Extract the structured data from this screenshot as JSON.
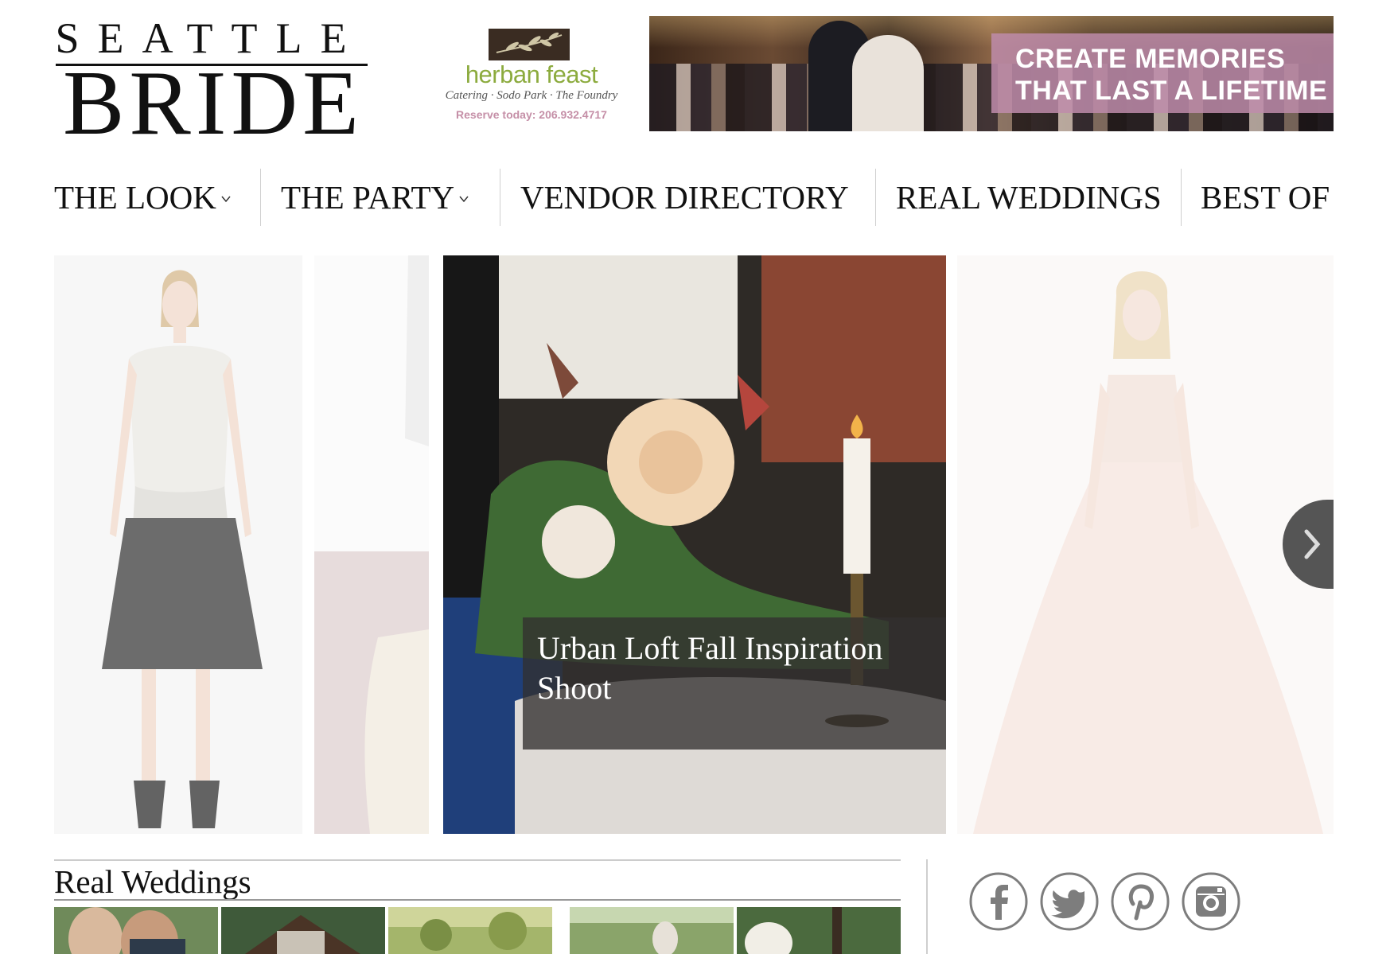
{
  "logo": {
    "top": "SEATTLE",
    "bottom": "BRIDE"
  },
  "ads": {
    "herban": {
      "mark_icon": "olive-branch-icon",
      "name": "herban feast",
      "tagline": "Catering · Sodo Park · The Foundry",
      "phone": "Reserve today: 206.932.4717"
    },
    "banner": {
      "line1": "CREATE MEMORIES",
      "line2": "THAT LAST A LIFETIME"
    }
  },
  "nav": {
    "items": [
      {
        "label": "THE LOOK",
        "dropdown": true
      },
      {
        "label": "THE PARTY",
        "dropdown": true
      },
      {
        "label": "VENDOR DIRECTORY",
        "dropdown": false
      },
      {
        "label": "REAL WEDDINGS",
        "dropdown": false
      },
      {
        "label": "BEST OF",
        "dropdown": false
      }
    ],
    "chevron_icon": "chevron-down-icon"
  },
  "carousel": {
    "caption": "Urban Loft Fall Inspiration Shoot",
    "next_icon": "chevron-right-icon"
  },
  "real_weddings": {
    "title": "Real Weddings"
  },
  "social": [
    {
      "name": "facebook-icon"
    },
    {
      "name": "twitter-icon"
    },
    {
      "name": "pinterest-icon"
    },
    {
      "name": "instagram-icon"
    }
  ],
  "colors": {
    "herban_green": "#8cab3e",
    "herban_pink": "#c58fa7",
    "ad_overlay": "#be8caa",
    "icon_gray": "#7d7d7d"
  }
}
